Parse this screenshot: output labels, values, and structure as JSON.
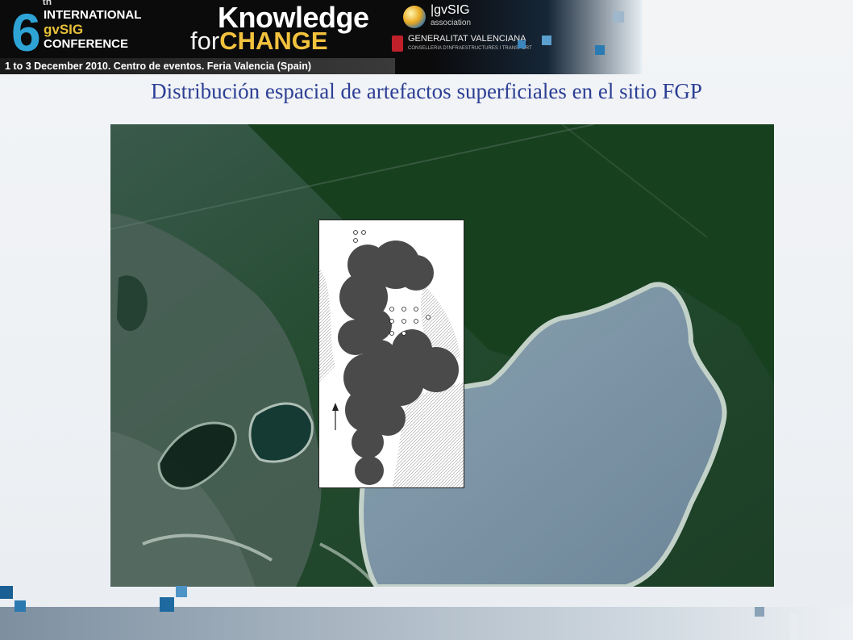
{
  "header": {
    "edition_number": "6",
    "edition_suffix": "th",
    "conference_line1": "INTERNATIONAL",
    "conference_line2": "gvSIG",
    "conference_line3": "CONFERENCE",
    "slogan_line1": "Knowledge",
    "slogan_line2_prefix": "for",
    "slogan_line2_highlight": "CHANGE",
    "association_name": "|gvSIG",
    "association_sub": "association",
    "sponsor_name": "GENERALITAT VALENCIANA",
    "sponsor_sub": "CONSELLERIA D'INFRAESTRUCTURES I TRANSPORT",
    "date_location": "1 to 3 December 2010. Centro de eventos. Feria Valencia (Spain)"
  },
  "slide": {
    "title": "Distribución espacial de artefactos superficiales en el sitio FGP"
  },
  "colors": {
    "title": "#2c3f95",
    "brand_blue": "#2ea3d6",
    "brand_yellow": "#f3c23d",
    "lake": "#7d97ab",
    "vegetation": "#1f4a2a"
  },
  "icons": {
    "gvsig_logo": "gvsig-globe-icon",
    "generalitat_logo": "bat-crest-icon",
    "north_arrow": "north-arrow-icon"
  }
}
